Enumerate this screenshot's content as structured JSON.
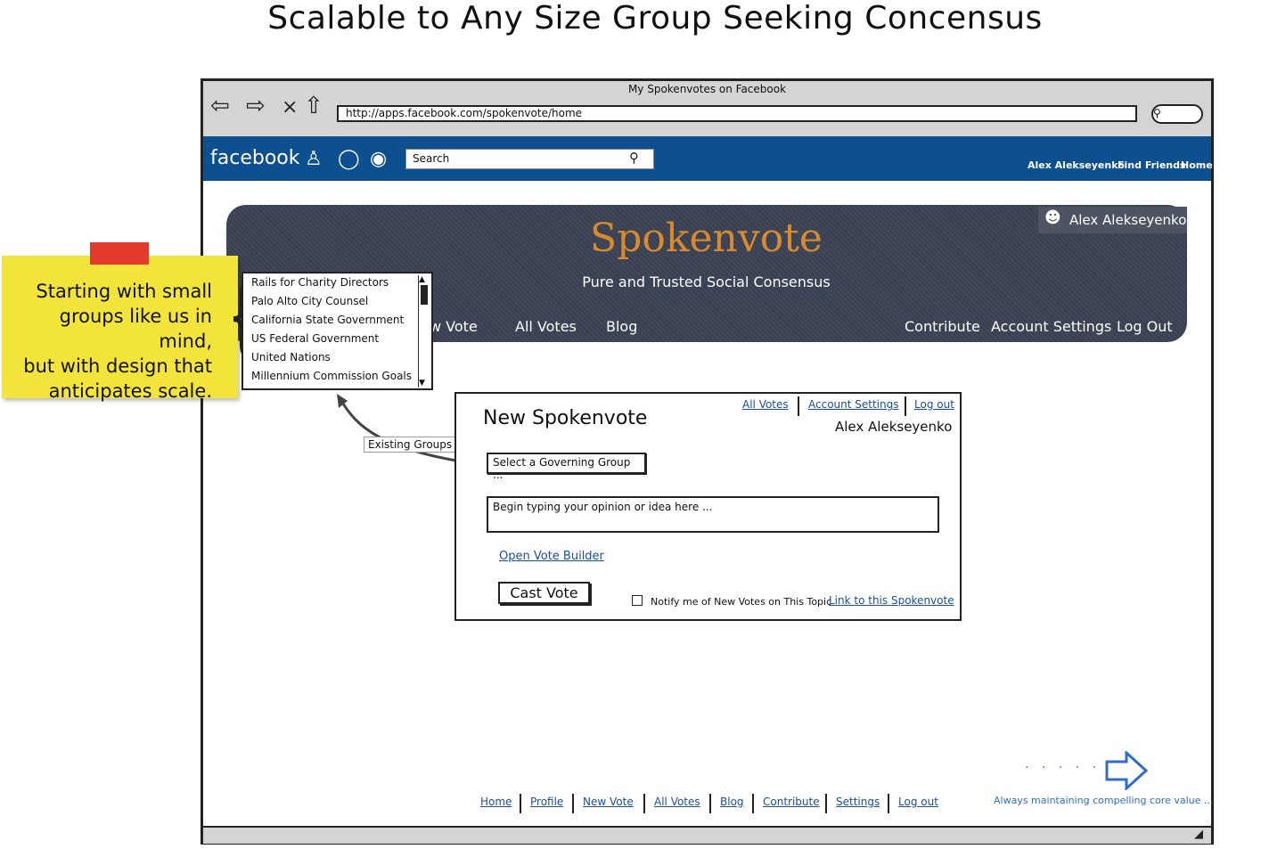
{
  "slide": {
    "title": "Scalable to Any Size Group Seeking Concensus"
  },
  "window": {
    "title": "My Spokenvotes on Facebook",
    "url": "http://apps.facebook.com/spokenvote/home",
    "nav_icons": [
      "back-arrow-icon",
      "forward-arrow-icon",
      "close-x-icon",
      "home-icon",
      "search-go-icon"
    ]
  },
  "facebook": {
    "logo": "facebook",
    "icons": [
      "friends-icon",
      "messages-icon",
      "notifications-globe-icon"
    ],
    "search_placeholder": "Search",
    "links": [
      "Alex Alekseyenko",
      "Find Friends",
      "Home"
    ],
    "colors": {
      "bar": "#0d4f8f"
    }
  },
  "banner": {
    "user": "Alex Alekseyenko",
    "title": "Spokenvote",
    "subtitle": "Pure and Trusted Social Consensus",
    "nav_left": [
      "w Vote",
      "All Votes",
      "Blog"
    ],
    "nav_right": [
      "Contribute",
      "Account Settings",
      "Log Out"
    ],
    "colors": {
      "title": "#d88a30"
    }
  },
  "sticky_note": {
    "lines": [
      "Starting with small",
      "groups like us in mind,",
      "but with design that",
      "anticipates scale."
    ]
  },
  "groups_list": {
    "items": [
      "Rails for Charity Directors",
      "Palo Alto City Counsel",
      "California State Government",
      "US Federal Government",
      "United Nations",
      "Millennium Commission Goals"
    ]
  },
  "callout": {
    "label": "Existing Groups"
  },
  "panel": {
    "title": "New Spokenvote",
    "top_links": [
      "All Votes",
      "Account Settings",
      "Log out"
    ],
    "user": "Alex Alekseyenko",
    "group_select": "Select a Governing Group ...",
    "opinion_placeholder": "Begin typing your opinion or idea here ...",
    "vote_builder": "Open Vote Builder",
    "cast_button": "Cast Vote",
    "notify_label": "Notify me of New Votes on This Topic",
    "notify_checked": false,
    "link_label": "Link to this Spokenvote"
  },
  "footer": {
    "links": [
      "Home",
      "Profile",
      "New Vote",
      "All Votes",
      "Blog",
      "Contribute",
      "Settings",
      "Log out"
    ]
  },
  "core_value": {
    "text": "Always maintaining compelling core value ..."
  }
}
